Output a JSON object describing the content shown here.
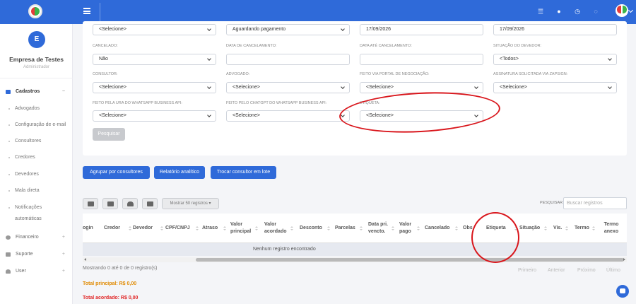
{
  "sidebar": {
    "avatar_letter": "E",
    "company": "Empresa de Testes",
    "role": "Administrador",
    "sections": [
      {
        "label": "Cadastros",
        "toggle": "−"
      },
      {
        "label": "Financeiro",
        "toggle": "+"
      },
      {
        "label": "Suporte",
        "toggle": "+"
      },
      {
        "label": "User",
        "toggle": "+"
      }
    ],
    "cadastros_items": [
      "Advogados",
      "Configuração de e-mail",
      "Consultores",
      "Credores",
      "Devedores",
      "Mala direta",
      "Notificações",
      "automáticas"
    ]
  },
  "filters": {
    "row0": [
      "<Selecione>",
      "Aguardando pagamento",
      "17/09/2026",
      "17/09/2026"
    ],
    "labels1": [
      "CANCELADO:",
      "DATA DE CANCELAMENTO:",
      "DATA ATÉ CANCELAMENTO:",
      "SITUAÇÃO DO DEVEDOR:"
    ],
    "values1": [
      "Não",
      "",
      "",
      "<Todos>"
    ],
    "labels2": [
      "CONSULTOR:",
      "ADVOGADO:",
      "FEITO VIA PORTAL DE NEGOCIAÇÃO:",
      "ASSINATURA SOLICITADA VIA ZAPSIGN:"
    ],
    "values2": [
      "<Selecione>",
      "<Selecione>",
      "<Selecione>",
      "<Selecione>"
    ],
    "labels3": [
      "FEITO PELA URA DO WHATSAPP BUSINESS API:",
      "FEITO PELO CHATGPT DO WHATSAPP BUSINESS API:",
      "ETIQUETA:"
    ],
    "values3": [
      "<Selecione>",
      "<Selecione>",
      "<Selecione>"
    ],
    "search_button": "Pesquisar"
  },
  "actions": {
    "group": "Agrupar por consultores",
    "report": "Relatório analítico",
    "swap": "Trocar consultor em lote"
  },
  "table": {
    "show_label": "Mostrar 50 registros",
    "search_label": "PESQUISAR",
    "search_placeholder": "Buscar registros",
    "columns": [
      "ogin",
      "Credor",
      "Devedor",
      "CPF/CNPJ",
      "Atraso",
      "Valor principal",
      "Valor acordado",
      "Desconto",
      "Parcelas",
      "Data pri. vencto.",
      "Valor pago",
      "Cancelado",
      "Obs",
      "Etiqueta",
      "Situação",
      "Vis.",
      "Termo",
      "Termo anexo"
    ],
    "empty": "Nenhum registro encontrado",
    "info": "Mostrando 0 até 0 de 0 registro(s)",
    "pagination": [
      "Primeiro",
      "Anterior",
      "Próximo",
      "Último"
    ]
  },
  "totals": {
    "principal": "Total principal: R$ 0,00",
    "acordado": "Total acordado: R$ 0,00"
  },
  "colors": {
    "primary": "#2f6ad9",
    "annotation": "#d9161c"
  }
}
